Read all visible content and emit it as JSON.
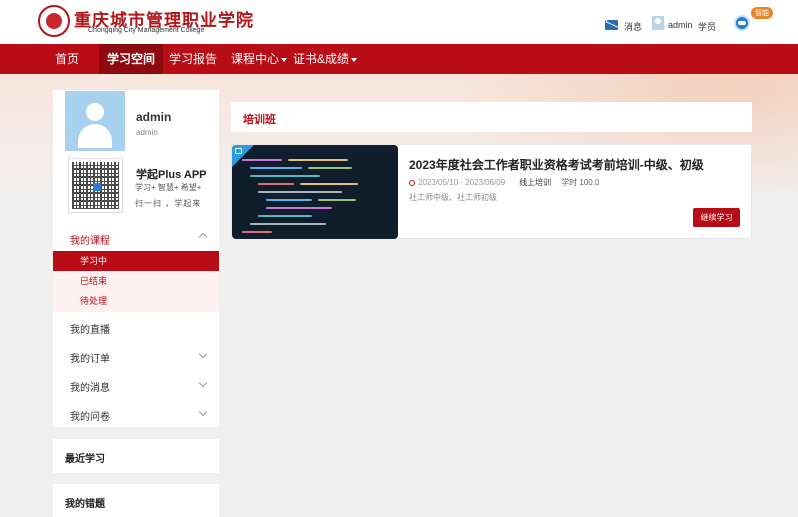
{
  "header": {
    "logo_cn": "重庆城市管理职业学院",
    "logo_en": "Chongqing City Management College",
    "messages_label": "消息",
    "username": "admin",
    "role": "学员",
    "assistant_badge": "智能",
    "icons": [
      "mail-icon",
      "user-icon",
      "robot-icon"
    ]
  },
  "nav": {
    "items": [
      {
        "label": "首页"
      },
      {
        "label": "学习空间",
        "active": true
      },
      {
        "label": "学习报告"
      },
      {
        "label": "课程中心",
        "dropdown": true
      },
      {
        "label": "证书&成绩",
        "dropdown": true
      }
    ]
  },
  "profile": {
    "name": "admin",
    "username": "admin",
    "app_title": "学起Plus APP",
    "app_tags": "学习+ 智慧+ 希望+",
    "app_scan": "扫一扫 ，学起来"
  },
  "menu": {
    "my_courses": "我的课程",
    "sub_items": [
      {
        "label": "学习中",
        "active": true
      },
      {
        "label": "已结束"
      },
      {
        "label": "待处理"
      }
    ],
    "live": "我的直播",
    "orders": "我的订单",
    "messages": "我的消息",
    "questionnaire": "我的问卷"
  },
  "panels": {
    "recent": "最近学习",
    "mistakes": "我的错题"
  },
  "main": {
    "section_title": "培训班",
    "course": {
      "title": "2023年度社会工作者职业资格考试考前培训-中级、初级",
      "date_range": "2023/05/10 - 2023/06/09",
      "mode": "线上培训",
      "hours": "学时 100.0",
      "tags": "社工师中级、社工师初级",
      "button": "继续学习"
    }
  },
  "colors": {
    "brand_red": "#b80c16",
    "nav_active": "#8e0810",
    "badge_blue": "#2b9be3",
    "badge_orange": "#e8842a"
  }
}
